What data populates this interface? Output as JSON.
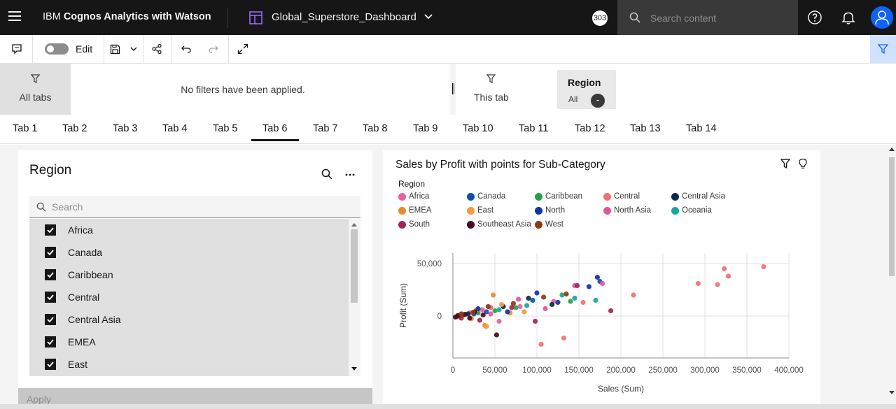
{
  "header": {
    "brand_prefix": "IBM",
    "brand_suffix": "Cognos Analytics with Watson",
    "dashboard_name": "Global_Superstore_Dashboard",
    "badge_count": "303",
    "search_placeholder": "Search content"
  },
  "toolbar": {
    "edit_label": "Edit"
  },
  "filters": {
    "all_tabs_label": "All tabs",
    "no_filters_text": "No filters have been applied.",
    "this_tab_label": "This tab",
    "chip_title": "Region",
    "chip_value": "All",
    "chip_remove": "-"
  },
  "tabs": [
    "Tab 1",
    "Tab 2",
    "Tab 3",
    "Tab 4",
    "Tab 5",
    "Tab 6",
    "Tab 7",
    "Tab 8",
    "Tab 9",
    "Tab 10",
    "Tab 11",
    "Tab 12",
    "Tab 13",
    "Tab 14"
  ],
  "active_tab": "Tab 6",
  "region_panel": {
    "title": "Region",
    "search_placeholder": "Search",
    "items": [
      "Africa",
      "Canada",
      "Caribbean",
      "Central",
      "Central Asia",
      "EMEA",
      "East"
    ],
    "apply_label": "Apply"
  },
  "chart_panel": {
    "title": "Sales by Profit with points for Sub-Category",
    "legend_title": "Region"
  },
  "chart_data": {
    "type": "scatter",
    "title": "Sales by Profit with points for Sub-Category",
    "xlabel": "Sales (Sum)",
    "ylabel": "Profit (Sum)",
    "xlim": [
      0,
      400000
    ],
    "ylim": [
      -40000,
      60000
    ],
    "xticks": [
      0,
      50000,
      100000,
      150000,
      200000,
      250000,
      300000,
      350000,
      400000
    ],
    "xtick_labels": [
      "0",
      "50,000",
      "100,000",
      "150,000",
      "200,000",
      "250,000",
      "300,000",
      "350,000",
      "400,000"
    ],
    "yticks": [
      0,
      50000
    ],
    "ytick_labels": [
      "0",
      "50,000"
    ],
    "grid": true,
    "legend_placement": "top-left",
    "series": [
      {
        "name": "Africa",
        "color": "#e8609a",
        "points": [
          [
            20000,
            3000
          ],
          [
            35000,
            6000
          ],
          [
            45000,
            8000
          ],
          [
            55000,
            -5000
          ],
          [
            80000,
            9000
          ],
          [
            120000,
            14000
          ]
        ]
      },
      {
        "name": "Canada",
        "color": "#0f4fb5",
        "points": [
          [
            10000,
            1000
          ],
          [
            25000,
            2000
          ],
          [
            40000,
            4000
          ],
          [
            95000,
            15000
          ],
          [
            175000,
            33000
          ]
        ]
      },
      {
        "name": "Caribbean",
        "color": "#24a148",
        "points": [
          [
            15000,
            1500
          ],
          [
            30000,
            3000
          ],
          [
            50000,
            5000
          ],
          [
            75000,
            8000
          ],
          [
            140000,
            14000
          ]
        ]
      },
      {
        "name": "Central",
        "color": "#f27070",
        "points": [
          [
            215000,
            20000
          ],
          [
            292000,
            31000
          ],
          [
            315000,
            30000
          ],
          [
            323000,
            45000
          ],
          [
            328000,
            38000
          ],
          [
            370000,
            47000
          ],
          [
            105000,
            -27000
          ],
          [
            132000,
            -21000
          ],
          [
            155000,
            13000
          ]
        ]
      },
      {
        "name": "Central Asia",
        "color": "#0b2a4a",
        "points": [
          [
            5000,
            -500
          ],
          [
            18000,
            2000
          ],
          [
            60000,
            9000
          ],
          [
            90000,
            17000
          ],
          [
            118000,
            11000
          ]
        ]
      },
      {
        "name": "EMEA",
        "color": "#e88a2e",
        "points": [
          [
            8000,
            -1000
          ],
          [
            22000,
            -2500
          ],
          [
            38000,
            -9000
          ],
          [
            48000,
            20000
          ],
          [
            68000,
            3000
          ]
        ]
      },
      {
        "name": "East",
        "color": "#f59a3c",
        "points": [
          [
            12000,
            500
          ],
          [
            28000,
            6000
          ],
          [
            40000,
            -10000
          ],
          [
            58000,
            11000
          ],
          [
            85000,
            4000
          ]
        ]
      },
      {
        "name": "North",
        "color": "#1132a8",
        "points": [
          [
            30000,
            7000
          ],
          [
            65000,
            4000
          ],
          [
            100000,
            22000
          ],
          [
            125000,
            13000
          ],
          [
            162000,
            28000
          ],
          [
            172000,
            37000
          ]
        ]
      },
      {
        "name": "North Asia",
        "color": "#e3559a",
        "points": [
          [
            45000,
            2000
          ],
          [
            78000,
            16000
          ],
          [
            110000,
            7000
          ],
          [
            145000,
            29000
          ],
          [
            178000,
            31000
          ]
        ]
      },
      {
        "name": "Oceania",
        "color": "#1aa5a0",
        "points": [
          [
            55000,
            6000
          ],
          [
            88000,
            10000
          ],
          [
            130000,
            20000
          ],
          [
            145000,
            17000
          ],
          [
            170000,
            15000
          ]
        ]
      },
      {
        "name": "South",
        "color": "#a3245a",
        "points": [
          [
            10000,
            -2000
          ],
          [
            32000,
            -4000
          ],
          [
            70000,
            8000
          ],
          [
            98000,
            -5000
          ],
          [
            148000,
            29000
          ],
          [
            188000,
            5000
          ]
        ]
      },
      {
        "name": "Southeast Asia",
        "color": "#4b0a1e",
        "points": [
          [
            3000,
            -1000
          ],
          [
            6000,
            500
          ],
          [
            14000,
            1500
          ],
          [
            20000,
            -2000
          ],
          [
            26000,
            4000
          ],
          [
            36000,
            1000
          ],
          [
            52000,
            -18000
          ]
        ]
      },
      {
        "name": "West",
        "color": "#8c3a10",
        "points": [
          [
            10000,
            2000
          ],
          [
            24000,
            3500
          ],
          [
            42000,
            9000
          ],
          [
            72000,
            12000
          ],
          [
            108000,
            18000
          ],
          [
            135000,
            21000
          ]
        ]
      }
    ]
  }
}
